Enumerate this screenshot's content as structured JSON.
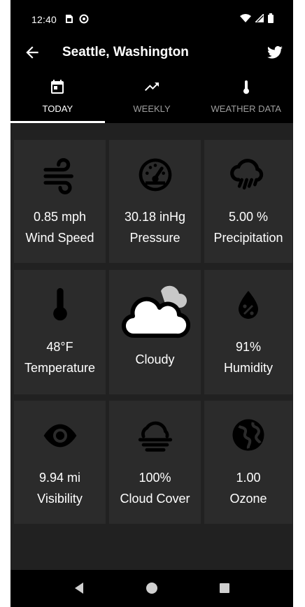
{
  "status_bar": {
    "time": "12:40",
    "icons": [
      "sim-card-icon",
      "data-saver-icon",
      "wifi-icon",
      "signal-icon",
      "battery-icon"
    ]
  },
  "app_bar": {
    "title": "Seattle, Washington",
    "back_icon": "arrow-back-icon",
    "share_icon": "twitter-icon"
  },
  "tabs": [
    {
      "label": "TODAY",
      "icon": "calendar-icon",
      "active": true
    },
    {
      "label": "WEEKLY",
      "icon": "trending-up-icon",
      "active": false
    },
    {
      "label": "WEATHER DATA",
      "icon": "thermometer-icon",
      "active": false
    }
  ],
  "cards": [
    {
      "value": "0.85 mph",
      "label": "Wind Speed",
      "icon": "wind-icon"
    },
    {
      "value": "30.18 inHg",
      "label": "Pressure",
      "icon": "gauge-icon"
    },
    {
      "value": "5.00 %",
      "label": "Precipitation",
      "icon": "rain-cloud-icon"
    },
    {
      "value": "48°F",
      "label": "Temperature",
      "icon": "thermometer-icon"
    },
    {
      "value": "Cloudy",
      "label": "",
      "icon": "cloudy-icon"
    },
    {
      "value": "91%",
      "label": "Humidity",
      "icon": "humidity-drop-icon"
    },
    {
      "value": "9.94 mi",
      "label": "Visibility",
      "icon": "eye-icon"
    },
    {
      "value": "100%",
      "label": "Cloud Cover",
      "icon": "fog-cloud-icon"
    },
    {
      "value": "1.00",
      "label": "Ozone",
      "icon": "globe-icon"
    }
  ],
  "nav_bar": {
    "buttons": [
      "back-triangle-icon",
      "home-circle-icon",
      "recents-square-icon"
    ]
  },
  "colors": {
    "background": "#212121",
    "card": "#2b2b2b",
    "bar": "#000000",
    "text": "#ffffff",
    "inactive_tab": "#9e9e9e"
  }
}
